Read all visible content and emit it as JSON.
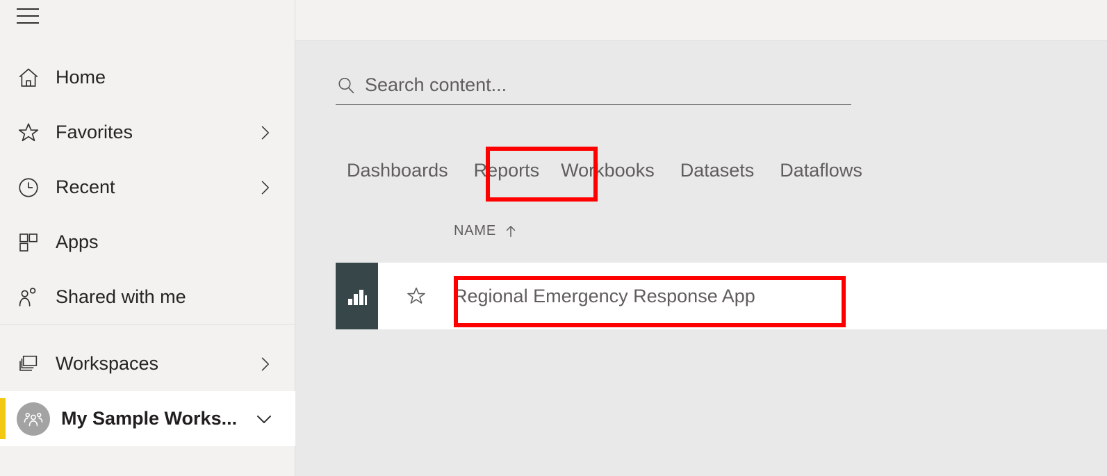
{
  "sidebar": {
    "menu_icon": "hamburger-icon",
    "primary_items": [
      {
        "label": "Home",
        "icon": "home-icon",
        "chevron": false
      },
      {
        "label": "Favorites",
        "icon": "star-icon",
        "chevron": true
      },
      {
        "label": "Recent",
        "icon": "clock-icon",
        "chevron": true
      },
      {
        "label": "Apps",
        "icon": "apps-grid-icon",
        "chevron": false
      },
      {
        "label": "Shared with me",
        "icon": "people-share-icon",
        "chevron": false
      }
    ],
    "secondary_items": [
      {
        "label": "Workspaces",
        "icon": "workspaces-stack-icon",
        "chevron": true
      }
    ],
    "workspace": {
      "label": "My Sample Works...",
      "avatar_icon": "group-avatar-icon",
      "chevron_icon": "chevron-down-icon",
      "selected": true,
      "accent_color": "#F2C811"
    }
  },
  "main": {
    "search": {
      "icon": "search-icon",
      "placeholder": "Search content...",
      "value": ""
    },
    "tabs": [
      {
        "label": "Dashboards",
        "highlighted": false
      },
      {
        "label": "Reports",
        "highlighted": true
      },
      {
        "label": "Workbooks",
        "highlighted": false
      },
      {
        "label": "Datasets",
        "highlighted": false
      },
      {
        "label": "Dataflows",
        "highlighted": false
      }
    ],
    "table": {
      "columns": [
        {
          "label": "NAME",
          "sort": "ascending",
          "sort_icon": "arrow-up-icon"
        }
      ],
      "rows": [
        {
          "type_icon": "report-bar-chart-icon",
          "type_icon_bg": "#374649",
          "favorite_icon": "star-outline-icon",
          "name": "Regional Emergency Response App",
          "highlighted": true
        }
      ]
    },
    "annotation_color": "#FF0000"
  }
}
